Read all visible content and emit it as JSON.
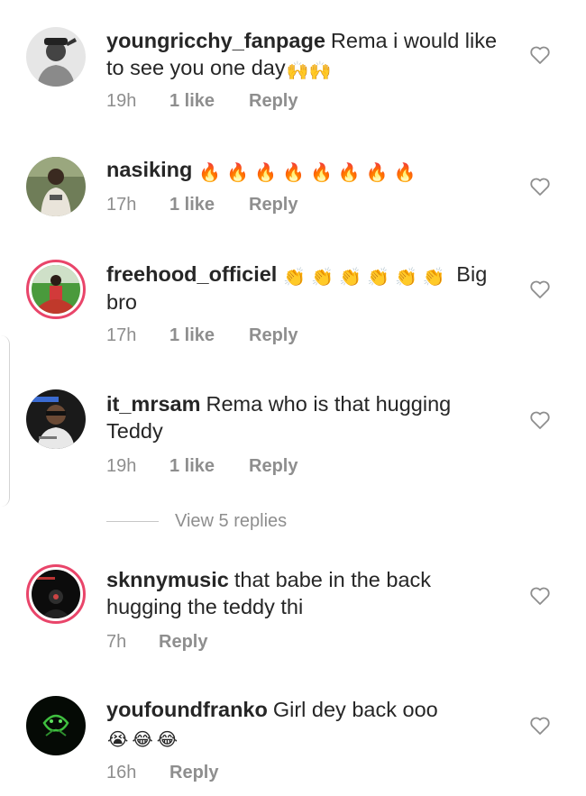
{
  "comments": [
    {
      "username": "youngricchy_fanpage",
      "text": "Rema i would like to see you one day",
      "emoji": "🙌🙌",
      "time": "19h",
      "likes": "1 like",
      "reply": "Reply",
      "avatar_ring": false
    },
    {
      "username": "nasiking",
      "text": "",
      "emoji": "🔥🔥🔥🔥🔥🔥🔥🔥",
      "time": "17h",
      "likes": "1 like",
      "reply": "Reply",
      "avatar_ring": false
    },
    {
      "username": "freehood_officiel",
      "text": "",
      "emoji": "👏👏👏👏👏👏",
      "text_after": "Big bro",
      "time": "17h",
      "likes": "1 like",
      "reply": "Reply",
      "avatar_ring": true
    },
    {
      "username": "it_mrsam",
      "text": "Rema who is that hugging Teddy",
      "time": "19h",
      "likes": "1 like",
      "reply": "Reply",
      "avatar_ring": false
    },
    {
      "username": "sknnymusic",
      "text": "that babe in the back hugging the teddy thi",
      "time": "7h",
      "reply": "Reply",
      "avatar_ring": true
    },
    {
      "username": "youfoundfranko",
      "text": "Girl dey back ooo",
      "emoji": "😭😂😂",
      "time": "16h",
      "reply": "Reply",
      "avatar_ring": false
    }
  ],
  "view_replies": "View 5 replies",
  "colors": {
    "text": "#262626",
    "muted": "#8e8e8e",
    "story_ring": "#e9456a"
  },
  "icons": {
    "like": "heart-outline-icon"
  }
}
